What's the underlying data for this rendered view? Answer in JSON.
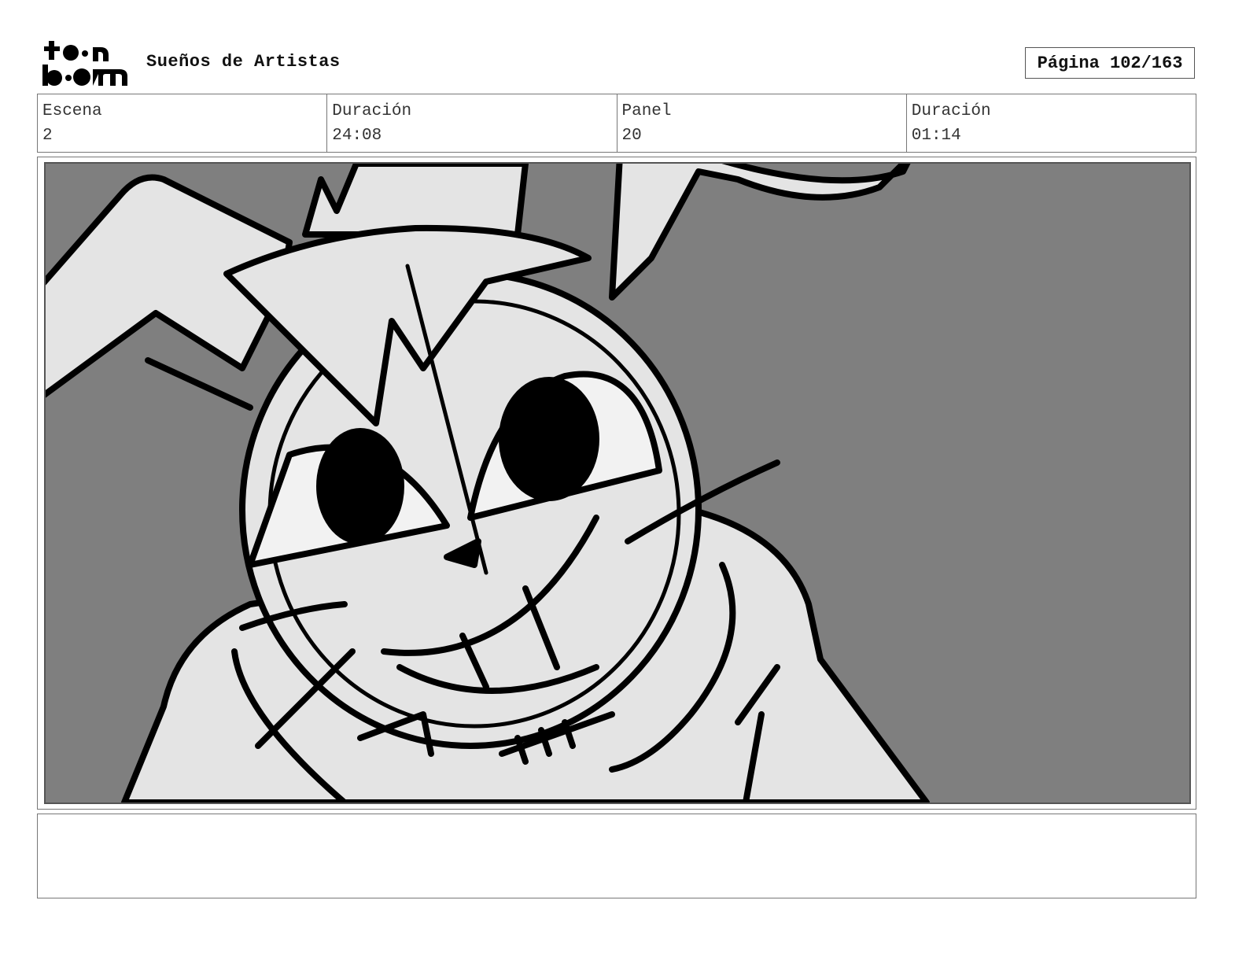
{
  "header": {
    "logo_text": "toon boom",
    "project_title": "Sueños de Artistas",
    "page_label": "Página 102/163"
  },
  "info": {
    "scene_label": "Escena",
    "scene_value": "2",
    "scene_duration_label": "Duración",
    "scene_duration_value": "24:08",
    "panel_label": "Panel",
    "panel_value": "20",
    "panel_duration_label": "Duración",
    "panel_duration_value": "01:14"
  },
  "notes": {
    "text": ""
  },
  "colors": {
    "background": "#7f7f7f",
    "character_fill": "#e4e4e4",
    "ink": "#000000"
  }
}
